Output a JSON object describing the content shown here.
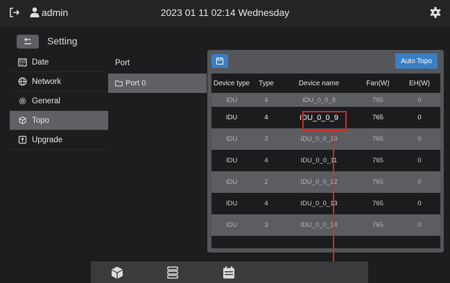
{
  "topbar": {
    "username": "admin",
    "datetime": "2023 01 11 02:14 Wednesday",
    "icons": [
      "logout-icon",
      "user-icon",
      "gear-icon"
    ]
  },
  "header": {
    "title": "Setting"
  },
  "menu": {
    "items": [
      {
        "label": "Date",
        "icon": "calendar-icon"
      },
      {
        "label": "Network",
        "icon": "globe-icon"
      },
      {
        "label": "General",
        "icon": "gear-icon"
      },
      {
        "label": "Topo",
        "icon": "topology-icon",
        "active": true
      },
      {
        "label": "Upgrade",
        "icon": "upgrade-icon"
      }
    ]
  },
  "port": {
    "header": "Port",
    "items": [
      "Port 0"
    ]
  },
  "panel": {
    "auto_topo_label": "Auto Topo"
  },
  "table": {
    "columns": [
      "Device type",
      "Type",
      "Device name",
      "Fan(W)",
      "EH(W)"
    ],
    "rows": [
      [
        "IDU",
        "4",
        "IDU_0_0_8",
        "765",
        "0"
      ],
      [
        "IDU",
        "4",
        "IDU_0_0_9",
        "765",
        "0"
      ],
      [
        "IDU",
        "3",
        "IDU_0_0_10",
        "765",
        "0"
      ],
      [
        "IDU",
        "4",
        "IDU_0_0_11",
        "765",
        "0"
      ],
      [
        "IDU",
        "2",
        "IDU_0_0_12",
        "765",
        "0"
      ],
      [
        "IDU",
        "4",
        "IDU_0_0_13",
        "765",
        "0"
      ],
      [
        "IDU",
        "3",
        "IDU_0_0_14",
        "765",
        "0"
      ]
    ]
  },
  "colors": {
    "accent": "#3a7fc4",
    "highlight": "#d12b2b",
    "active_row": "#5f6164"
  },
  "dock": {
    "icons": [
      "cube-icon",
      "list-icon",
      "calendar-icon"
    ]
  }
}
